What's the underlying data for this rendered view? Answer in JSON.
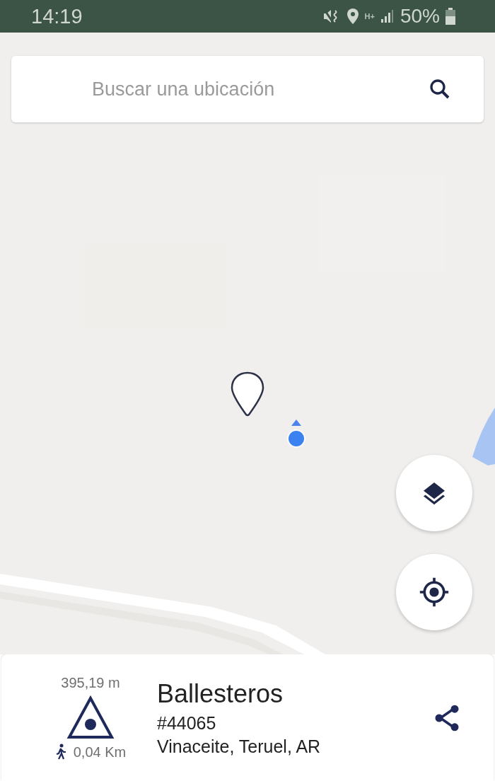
{
  "status_bar": {
    "time": "14:19",
    "battery": "50%",
    "network": "H+"
  },
  "search": {
    "placeholder": "Buscar una ubicación"
  },
  "place": {
    "distance": "395,19 m",
    "walking_distance": "0,04 Km",
    "name": "Ballesteros",
    "id": "#44065",
    "location": "Vinaceite, Teruel, AR"
  }
}
